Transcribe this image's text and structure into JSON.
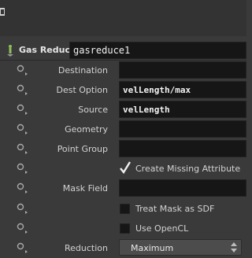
{
  "node": {
    "type_label": "Gas Reduce",
    "name": "gasreduce1",
    "type_icon": "node-gear-icon"
  },
  "params": {
    "destination": {
      "label": "Destination",
      "value": ""
    },
    "dest_option": {
      "label": "Dest Option",
      "value": "velLength/max"
    },
    "source": {
      "label": "Source",
      "value": "velLength"
    },
    "geometry": {
      "label": "Geometry",
      "value": ""
    },
    "point_group": {
      "label": "Point Group",
      "value": ""
    },
    "create_missing": {
      "label": "Create Missing Attribute",
      "checked": true
    },
    "mask_field": {
      "label": "Mask Field",
      "value": ""
    },
    "treat_mask_sdf": {
      "label": "Treat Mask as SDF",
      "checked": false
    },
    "use_opencl": {
      "label": "Use OpenCL",
      "checked": false
    },
    "reduction": {
      "label": "Reduction",
      "value": "Maximum"
    }
  },
  "colors": {
    "panel_bg": "#3a3a3a",
    "field_bg": "#161616",
    "text": "#d2d2d2",
    "value_text": "#f2f2f2"
  }
}
